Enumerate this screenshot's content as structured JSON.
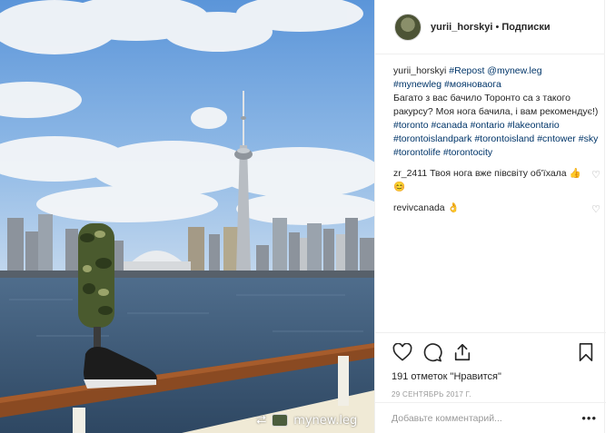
{
  "header": {
    "username": "yurii_horskyi",
    "separator": "•",
    "follow_label": "Подписки"
  },
  "caption": {
    "username": "yurii_horskyi",
    "line1_link": "#Repost @mynew.leg",
    "line2_links": "#mynewleg #мояноваога",
    "text": "Багато з вас бачило Торонто са з такого ракурсу? Моя нога бачила, і вам рекомендує!)",
    "tags": [
      "#toronto",
      "#canada",
      "#ontario",
      "#lakeontario",
      "#torontoislandpark",
      "#torontoisland",
      "#cntower",
      "#sky",
      "#torontolife",
      "#torontocity"
    ]
  },
  "comments": [
    {
      "username": "zr_2411",
      "text": "Твоя нога вже півсвіту об'їхала 👍😊"
    },
    {
      "username": "revivcanada",
      "text": "👌"
    }
  ],
  "photo": {
    "repost_icon": "⮂",
    "repost_handle": "mynew.leg"
  },
  "actions": {
    "likes_label": "191 отметок \"Нравится\"",
    "date": "29 СЕНТЯБРЬ 2017 Г."
  },
  "add_comment": {
    "placeholder": "Добавьте комментарий...",
    "more_label": "•••"
  },
  "colors": {
    "link": "#003569",
    "text": "#262626",
    "muted": "#999999",
    "border": "#efefef"
  }
}
